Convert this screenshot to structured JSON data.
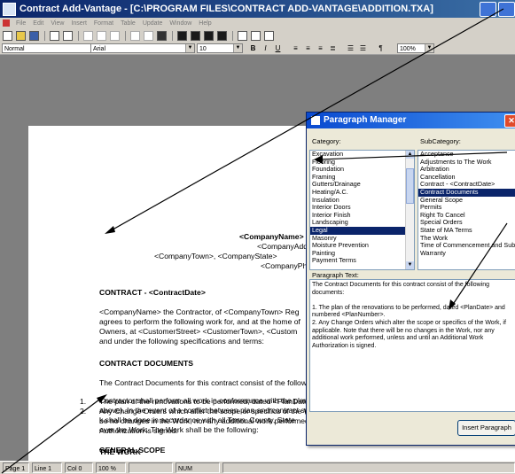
{
  "window": {
    "title": "Contract Add-Vantage - [C:\\PROGRAM FILES\\CONTRACT ADD-VANTAGE\\ADDITION.TXA]"
  },
  "menu": [
    "File",
    "Edit",
    "View",
    "Insert",
    "Format",
    "Table",
    "Update",
    "Window",
    "Help"
  ],
  "toolbar": {
    "style": "Normal",
    "font": "Arial",
    "size": "10",
    "zoom": "100%",
    "bold": "B",
    "italic": "I",
    "underline": "U",
    "paragraph_mark": "¶"
  },
  "document": {
    "header_company": "<CompanyName>",
    "header_address": "<CompanyAddress>",
    "header_town": "<CompanyTown>, <CompanyState>",
    "header_phone": "<CompanyPhone>",
    "contract_heading": "CONTRACT - <ContractDate>",
    "intro_line1": "<CompanyName> the Contractor, of <CompanyTown> Reg",
    "intro_line2": "agrees to perform the following work for, and at the home of",
    "intro_line3": "Owners, at <CustomerStreet>  <CustomerTown>,  <Custom",
    "intro_line4": "and under the following specifications and terms:",
    "section1_heading": "CONTRACT DOCUMENTS",
    "section1_text": "The Contract Documents for this contract consist of the follow",
    "item1_num": "1.",
    "item1_text": "The plan of the renovations to be performed, dated <PlanDate",
    "item2_num": "2.",
    "item2_line1": "Any Change Orders which alter the scope or specifics of the W",
    "item2_line2": "be no changes in the Work, nor any additional work performed",
    "item2_line3": "Authorization is signed.",
    "section2_heading": "THE WORK",
    "work_line1": "Contractor shall perform all work in conformance with the plan",
    "work_line2": "above). In the event of a conflict between plan and contract sp",
    "work_line3": "k shall be done in accordance with all Town, County, State",
    "work_line4": "over the Work. The Work shall be the following:",
    "section3_heading": "GENERAL SCOPE"
  },
  "status": {
    "page": "Page 1",
    "line": "Line 1",
    "col": "Col 0",
    "zoom": "100 %",
    "num": "NUM"
  },
  "dialog": {
    "title": "Paragraph Manager",
    "category_label": "Category:",
    "subcategory_label": "SubCategory:",
    "categories": [
      "Excavation",
      "Flooring",
      "Foundation",
      "Framing",
      "Gutters/Drainage",
      "Heating/A.C.",
      "Insulation",
      "Interior Doors",
      "Interior Finish",
      "Landscaping",
      "Legal",
      "Masonry",
      "Moisture Prevention",
      "Painting",
      "Payment Terms"
    ],
    "selected_category": "Legal",
    "subcategories": [
      "Acceptance",
      "Adjustments to The Work",
      "Arbitration",
      "Cancellation",
      "Contract - <ContractDate>",
      "Contract Documents",
      "General Scope",
      "Permits",
      "Right To Cancel",
      "Special Orders",
      "State of MA Terms",
      "The Work",
      "Time of Commencement and Substantial Completion",
      "Warranty"
    ],
    "selected_subcategory": "Contract Documents",
    "paragraph_label": "Paragraph Text:",
    "paragraph_text": "The Contract Documents for this contract consist of the following documents:\n\n1. The plan of the renovations to be performed, dated <PlanDate> and numbered <PlanNumber>.\n2. Any Change Orders which alter the scope or specifics of the Work, if applicable. Note that there will be no changes in the Work, nor any additional work performed, unless and until an Additional Work Authorization is signed.",
    "insert_button": "Insert Paragraph"
  },
  "colors": {
    "title_bar": "#0a246a",
    "dialog_title": "#0a4ad0",
    "selection": "#0a246a",
    "workspace": "#7f7f7f"
  }
}
